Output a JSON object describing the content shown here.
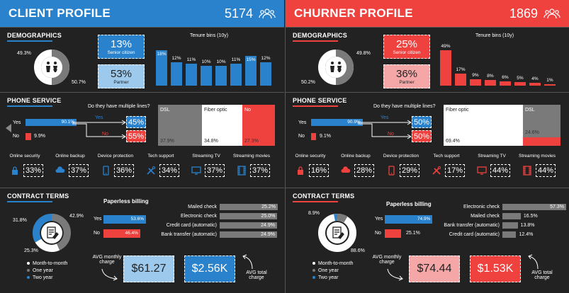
{
  "colors": {
    "client": "#2a82cc",
    "churner": "#ef423f",
    "client_light": "#9cc9ec",
    "churner_light": "#f4a7a6",
    "gray": "#7a7a7a",
    "bg": "#222222"
  },
  "client": {
    "title": "CLIENT PROFILE",
    "count": "5174",
    "demographics": {
      "title": "DEMOGRAPHICS",
      "gender_left": "49.3%",
      "gender_right": "50.7%",
      "senior_value": "13%",
      "senior_label": "Senior citizen",
      "partner_value": "53%",
      "partner_label": "Partner",
      "tenure_title": "Tenure bins (10y)",
      "tenure_labels": [
        "18%",
        "12%",
        "11%",
        "10%",
        "10%",
        "11%",
        "15%",
        "12%"
      ],
      "tenure_values": [
        18,
        12,
        11,
        10,
        10,
        11,
        15,
        12
      ]
    },
    "phone": {
      "title": "PHONE SERVICE",
      "yes_label": "Yes",
      "no_label": "No",
      "yes_pct": "90.1%",
      "no_pct": "9.9%",
      "yes_value": 90.1,
      "no_value": 9.9,
      "multi_question": "Do they have multiple lines?",
      "multi_yes_label": "Yes",
      "multi_no_label": "No",
      "multi_yes": "45%",
      "multi_no": "55%",
      "internet": [
        {
          "name": "DSL",
          "pct": "37.9%"
        },
        {
          "name": "Fiber optic",
          "pct": "34.8%"
        },
        {
          "name": "No",
          "pct": "27.3%"
        }
      ],
      "features": [
        {
          "name": "Online security",
          "value": "33%",
          "icon": "lock-icon"
        },
        {
          "name": "Online backup",
          "value": "37%",
          "icon": "cloud-icon"
        },
        {
          "name": "Device protection",
          "value": "36%",
          "icon": "phone-icon"
        },
        {
          "name": "Tech support",
          "value": "34%",
          "icon": "tools-icon"
        },
        {
          "name": "Streaming TV",
          "value": "37%",
          "icon": "tv-icon"
        },
        {
          "name": "Streaming movies",
          "value": "37%",
          "icon": "film-icon"
        }
      ]
    },
    "contract": {
      "title": "CONTRACT TERMS",
      "pie_labels": [
        "42.9%",
        "31.8%",
        "25.3%"
      ],
      "legend": [
        "Month-to-month",
        "One year",
        "Two year"
      ],
      "paperless_title": "Paperless billing",
      "paperless_yes_label": "Yes",
      "paperless_no_label": "No",
      "paperless_yes": "53.6%",
      "paperless_no": "46.4%",
      "paperless_yes_value": 53.6,
      "paperless_no_value": 46.4,
      "payment": [
        {
          "name": "Mailed check",
          "pct": "25.2%",
          "value": 25.2
        },
        {
          "name": "Electronic check",
          "pct": "25.0%",
          "value": 25.0
        },
        {
          "name": "Credit card (automatic)",
          "pct": "24.9%",
          "value": 24.9
        },
        {
          "name": "Bank transfer (automatic)",
          "pct": "24.9%",
          "value": 24.9
        }
      ],
      "avg_monthly_label": "AVG monthly charge",
      "avg_monthly": "$61.27",
      "avg_total_label": "AVG total charge",
      "avg_total": "$2.56K"
    }
  },
  "churner": {
    "title": "CHURNER PROFILE",
    "count": "1869",
    "demographics": {
      "title": "DEMOGRAPHICS",
      "gender_left": "50.2%",
      "gender_right": "49.8%",
      "senior_value": "25%",
      "senior_label": "Senior citizen",
      "partner_value": "36%",
      "partner_label": "Partner",
      "tenure_title": "Tenure bins (10y)",
      "tenure_labels": [
        "49%",
        "17%",
        "9%",
        "8%",
        "6%",
        "5%",
        "4%",
        "1%"
      ],
      "tenure_values": [
        49,
        17,
        9,
        8,
        6,
        5,
        4,
        1
      ]
    },
    "phone": {
      "title": "PHONE SERVICE",
      "yes_label": "Yes",
      "no_label": "No",
      "yes_pct": "90.9%",
      "no_pct": "9.1%",
      "yes_value": 90.9,
      "no_value": 9.1,
      "multi_question": "Do they have multiple lines?",
      "multi_yes_label": "Yes",
      "multi_no_label": "No",
      "multi_yes": "50%",
      "multi_no": "50%",
      "internet": [
        {
          "name": "Fiber optic",
          "pct": "69.4%"
        },
        {
          "name": "DSL",
          "pct": "24.6%"
        }
      ],
      "features": [
        {
          "name": "Online security",
          "value": "16%",
          "icon": "lock-icon"
        },
        {
          "name": "Online backup",
          "value": "28%",
          "icon": "cloud-icon"
        },
        {
          "name": "Device protection",
          "value": "29%",
          "icon": "phone-icon"
        },
        {
          "name": "Tech support",
          "value": "17%",
          "icon": "tools-icon"
        },
        {
          "name": "Streaming TV",
          "value": "44%",
          "icon": "tv-icon"
        },
        {
          "name": "Streaming movies",
          "value": "44%",
          "icon": "film-icon"
        }
      ]
    },
    "contract": {
      "title": "CONTRACT TERMS",
      "pie_labels": [
        "8.9%",
        "88.6%"
      ],
      "legend": [
        "Month-to-month",
        "One year",
        "Two year"
      ],
      "paperless_title": "Paperless billing",
      "paperless_yes_label": "Yes",
      "paperless_no_label": "No",
      "paperless_yes": "74.9%",
      "paperless_no": "25.1%",
      "paperless_yes_value": 74.9,
      "paperless_no_value": 25.1,
      "payment": [
        {
          "name": "Electronic check",
          "pct": "57.3%",
          "value": 57.3
        },
        {
          "name": "Mailed check",
          "pct": "16.5%",
          "value": 16.5
        },
        {
          "name": "Bank transfer (automatic)",
          "pct": "13.8%",
          "value": 13.8
        },
        {
          "name": "Credit card (automatic)",
          "pct": "12.4%",
          "value": 12.4
        }
      ],
      "avg_monthly_label": "AVG monthly charge",
      "avg_monthly": "$74.44",
      "avg_total_label": "AVG total charge",
      "avg_total": "$1.53K"
    }
  }
}
